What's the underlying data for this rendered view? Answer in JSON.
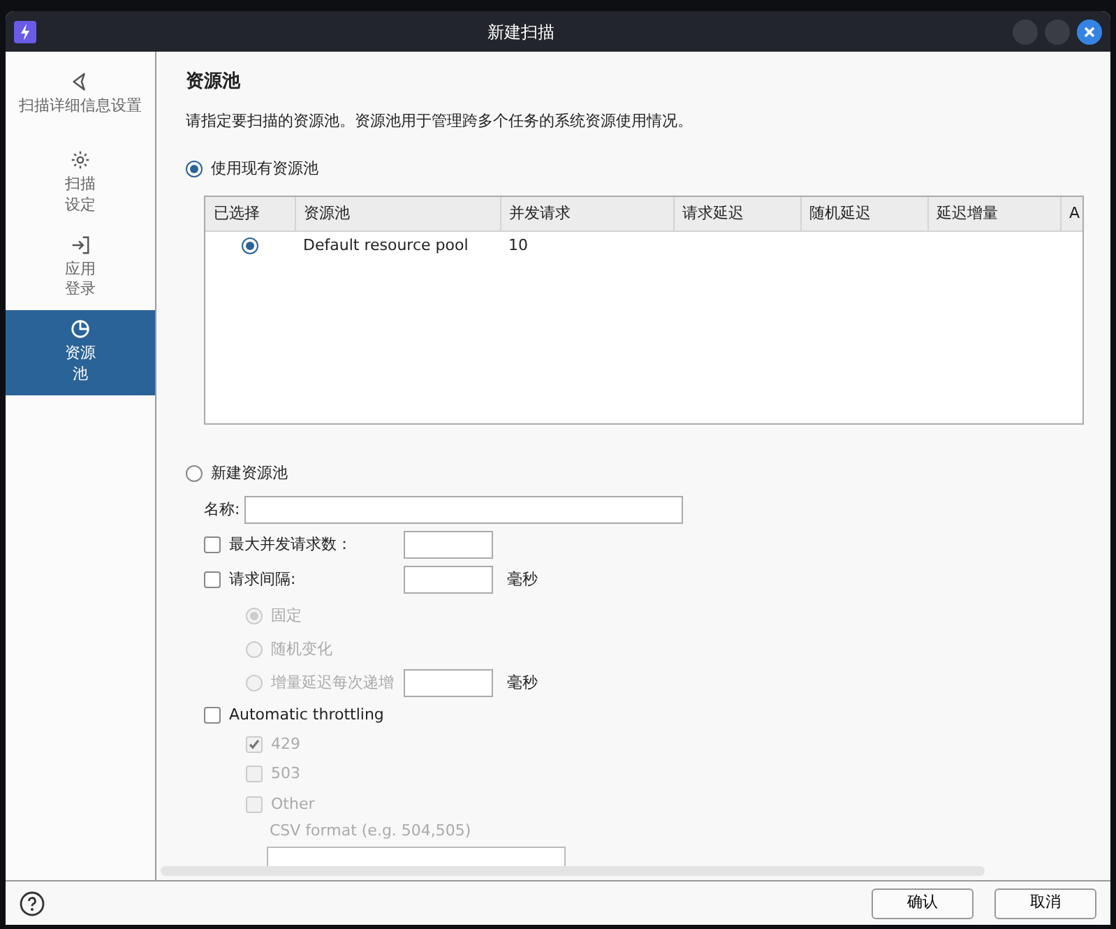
{
  "window": {
    "title": "新建扫描"
  },
  "sidebar": {
    "items": [
      {
        "label": "扫描详细信息设置",
        "selected": false
      },
      {
        "label": "扫描设定",
        "selected": false
      },
      {
        "label": "应用登录",
        "selected": false
      },
      {
        "label": "资源池",
        "selected": true
      }
    ]
  },
  "content": {
    "heading": "资源池",
    "description": "请指定要扫描的资源池。资源池用于管理跨多个任务的系统资源使用情况。",
    "existing_pool": {
      "label": "使用现有资源池",
      "selected": true
    },
    "table": {
      "columns": [
        "已选择",
        "资源池",
        "并发请求",
        "请求延迟",
        "随机延迟",
        "延迟增量",
        "A"
      ],
      "rows": [
        {
          "selected": true,
          "cells": [
            "",
            "Default resource pool",
            "10"
          ]
        }
      ]
    },
    "new_pool": {
      "label": "新建资源池",
      "selected": false
    },
    "name_field": {
      "label": "名称:"
    },
    "max_concurrent": {
      "label": "最大并发请求数：",
      "checked": false
    },
    "request_interval": {
      "label": "请求间隔:",
      "checked": false,
      "unit": "毫秒"
    },
    "interval_modes": [
      {
        "label": "固定",
        "selected": true,
        "disabled": true
      },
      {
        "label": "随机变化",
        "selected": false,
        "disabled": true
      },
      {
        "label": "增量延迟每次递增",
        "selected": false,
        "disabled": true,
        "unit": "毫秒"
      }
    ],
    "throttling": {
      "label": "Automatic throttling",
      "checked": false,
      "codes": [
        {
          "label": "429",
          "checked": true,
          "disabled": true
        },
        {
          "label": "503",
          "checked": false,
          "disabled": true
        },
        {
          "label": "Other",
          "checked": false,
          "disabled": true
        }
      ],
      "csv_label": "CSV format (e.g. 504,505)"
    }
  },
  "footer": {
    "buttons": [
      "确认",
      "取消"
    ]
  }
}
